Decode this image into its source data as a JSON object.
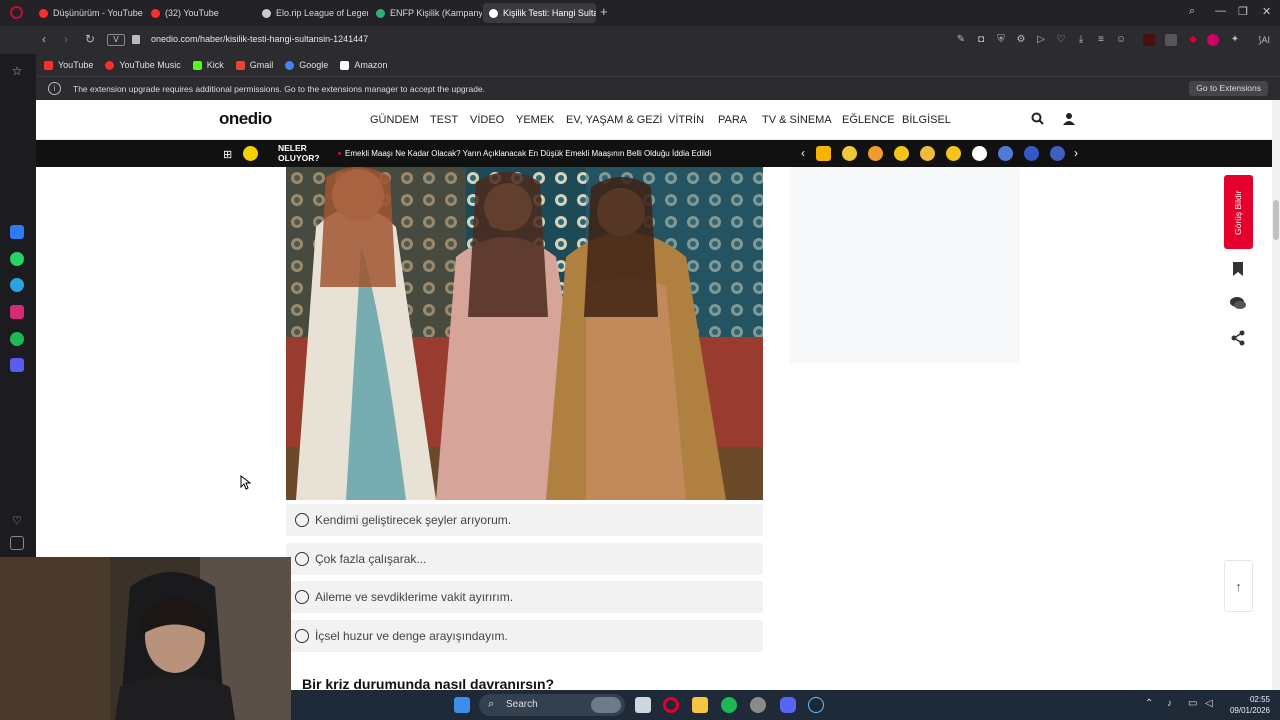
{
  "tabs": [
    {
      "title": "Düşünürüm - YouTube",
      "favicon_color": "#ff2d2d"
    },
    {
      "title": "(32) YouTube",
      "favicon_color": "#ff2d2d"
    },
    {
      "title": "Elo.rip League of Legends",
      "favicon_color": "#cccccc"
    },
    {
      "title": "ENFP Kişilik (Kampanyacı)",
      "favicon_color": "#2fb36a"
    },
    {
      "title": "Kişilik Testi: Hangi Sultansın",
      "favicon_color": "#ffffff"
    }
  ],
  "address_bar": {
    "url": "onedio.com/haber/kisilik-testi-hangi-sultansin-1241447",
    "site_badge": "V"
  },
  "bookmarks": [
    {
      "label": "YouTube",
      "color": "#ff2d2d"
    },
    {
      "label": "YouTube Music",
      "color": "#ff2d2d"
    },
    {
      "label": "Kick",
      "color": "#53fc18"
    },
    {
      "label": "Gmail",
      "color": "#ea4335"
    },
    {
      "label": "Google",
      "color": "#4285f4"
    },
    {
      "label": "Amazon",
      "color": "#ffffff"
    }
  ],
  "notice": {
    "text": "The extension upgrade requires additional permissions. Go to the extensions manager to accept the upgrade.",
    "button": "Go to Extensions"
  },
  "site": {
    "logo": "onedio",
    "nav": [
      "GÜNDEM",
      "TEST",
      "VİDEO",
      "YEMEK",
      "EV, YAŞAM & GEZİ",
      "VİTRİN",
      "PARA",
      "TV & SİNEMA",
      "EĞLENCE",
      "BİLGİSEL"
    ],
    "ticker_label_1": "NELER",
    "ticker_label_2": "OLUYOR?",
    "ticker_text": "Emekli Maaşı Ne Kadar Olacak? Yarın Açıklanacak En Düşük Emekli Maaşının Belli Olduğu İddia Edildi",
    "feedback": "Görüş Bildir",
    "options": [
      "Kendimi geliştirecek şeyler arıyorum.",
      "Çok fazla çalışarak...",
      "Aileme ve sevdiklerime vakit ayırırım.",
      "İçsel huzur ve denge arayışındayım."
    ],
    "next_question": "Bir kriz durumunda nasıl davranırsın?"
  },
  "taskbar": {
    "search": "Search",
    "time": "02:55",
    "date": "09/01/2026"
  },
  "colors": {
    "accent": "#e4002b",
    "taskbar": "#1f2a38"
  }
}
